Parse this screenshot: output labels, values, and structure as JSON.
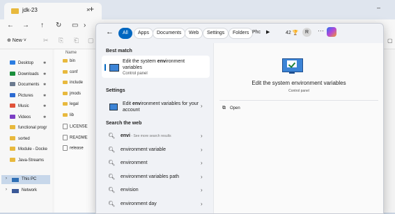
{
  "explorer": {
    "tab_title": "jdk-23",
    "tab_close": "×",
    "new_tab": "+",
    "minimize": "–",
    "nav": {
      "back": "←",
      "forward": "→",
      "up": "↑",
      "refresh": "↻",
      "display": "▭",
      "more": "›"
    },
    "cmd": {
      "new_label": "⊕ New ˅",
      "cut": "✂",
      "copy": "⎘",
      "paste": "⎗",
      "rename": "▢",
      "details": "▢"
    },
    "sidebar": [
      {
        "label": "Desktop",
        "pinned": true,
        "color": "#2b7de1"
      },
      {
        "label": "Downloads",
        "pinned": true,
        "color": "#1a8f3c"
      },
      {
        "label": "Documents",
        "pinned": true,
        "color": "#6b7a8f"
      },
      {
        "label": "Pictures",
        "pinned": true,
        "color": "#2b6ad1"
      },
      {
        "label": "Music",
        "pinned": true,
        "color": "#e0533a"
      },
      {
        "label": "Videos",
        "pinned": true,
        "color": "#7b3fc4"
      },
      {
        "label": "functional progr",
        "pinned": false,
        "color": "#e8b93d"
      },
      {
        "label": "sorted",
        "pinned": false,
        "color": "#e8b93d"
      },
      {
        "label": "Module - Docke",
        "pinned": false,
        "color": "#e8b93d"
      },
      {
        "label": "Java-Streams",
        "pinned": false,
        "color": "#e8b93d"
      }
    ],
    "pin_icon": "✱",
    "this_pc": "This PC",
    "network": "Network",
    "chevron": "›",
    "files_header": "Name",
    "files": [
      {
        "name": "bin",
        "type": "folder"
      },
      {
        "name": "conf",
        "type": "folder"
      },
      {
        "name": "include",
        "type": "folder"
      },
      {
        "name": "jmods",
        "type": "folder"
      },
      {
        "name": "legal",
        "type": "folder"
      },
      {
        "name": "lib",
        "type": "folder"
      },
      {
        "name": "LICENSE",
        "type": "file"
      },
      {
        "name": "README",
        "type": "file"
      },
      {
        "name": "release",
        "type": "file"
      }
    ]
  },
  "search": {
    "back": "←",
    "chips": [
      "All",
      "Apps",
      "Documents",
      "Web",
      "Settings",
      "Folders",
      "Phc"
    ],
    "play": "▶",
    "count": "42 🏆",
    "avatar": "R",
    "more": "···",
    "best_match_heading": "Best match",
    "best_match": {
      "title_pre": "Edit the system ",
      "title_bold": "env",
      "title_post": "ironment variables",
      "subtitle": "Control panel"
    },
    "settings_heading": "Settings",
    "settings_item": {
      "title_pre": "Edit ",
      "title_bold": "env",
      "title_post": "ironment variables for your account"
    },
    "web_heading": "Search the web",
    "web_items": [
      {
        "text": "envi",
        "hint": " - See more search results",
        "bold": true
      },
      {
        "text": "environment variable",
        "hint": "",
        "bold": false
      },
      {
        "text": "environment",
        "hint": "",
        "bold": false
      },
      {
        "text": "environment variables path",
        "hint": "",
        "bold": false
      },
      {
        "text": "envision",
        "hint": "",
        "bold": false
      },
      {
        "text": "environment day",
        "hint": "",
        "bold": false
      }
    ],
    "search_icon": "🔍︎",
    "arrow": "›",
    "detail": {
      "title": "Edit the system environment variables",
      "subtitle": "Control panel",
      "open_label": "Open",
      "open_icon": "⧉"
    }
  }
}
